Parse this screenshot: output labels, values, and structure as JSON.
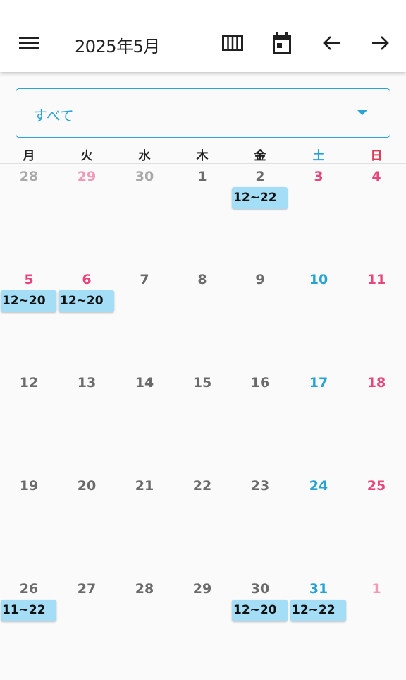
{
  "header": {
    "title": "2025年5月",
    "icons": [
      "menu-icon",
      "week-view-icon",
      "today-icon",
      "arrow-back-icon",
      "arrow-forward-icon"
    ]
  },
  "filter": {
    "selected": "すべて"
  },
  "weekdays": [
    "月",
    "火",
    "水",
    "木",
    "金",
    "土",
    "日"
  ],
  "colors": {
    "accent": "#2aa3d6",
    "saturday": "#25a3d5",
    "sunday_holiday": "#e8457a",
    "event_bg": "#a4ddf6",
    "out_of_month": "#a9a9a9"
  },
  "weeks": [
    [
      {
        "day": "28",
        "type": "out"
      },
      {
        "day": "29",
        "type": "out hol"
      },
      {
        "day": "30",
        "type": "out"
      },
      {
        "day": "1",
        "type": "normal"
      },
      {
        "day": "2",
        "type": "normal",
        "event": "12~22"
      },
      {
        "day": "3",
        "type": "hol"
      },
      {
        "day": "4",
        "type": "sun"
      }
    ],
    [
      {
        "day": "5",
        "type": "hol",
        "event": "12~20"
      },
      {
        "day": "6",
        "type": "hol",
        "event": "12~20"
      },
      {
        "day": "7",
        "type": "normal"
      },
      {
        "day": "8",
        "type": "normal"
      },
      {
        "day": "9",
        "type": "normal"
      },
      {
        "day": "10",
        "type": "sat"
      },
      {
        "day": "11",
        "type": "sun"
      }
    ],
    [
      {
        "day": "12",
        "type": "normal"
      },
      {
        "day": "13",
        "type": "normal"
      },
      {
        "day": "14",
        "type": "normal"
      },
      {
        "day": "15",
        "type": "normal"
      },
      {
        "day": "16",
        "type": "normal"
      },
      {
        "day": "17",
        "type": "sat"
      },
      {
        "day": "18",
        "type": "sun"
      }
    ],
    [
      {
        "day": "19",
        "type": "normal"
      },
      {
        "day": "20",
        "type": "normal"
      },
      {
        "day": "21",
        "type": "normal"
      },
      {
        "day": "22",
        "type": "normal"
      },
      {
        "day": "23",
        "type": "normal"
      },
      {
        "day": "24",
        "type": "sat"
      },
      {
        "day": "25",
        "type": "sun"
      }
    ],
    [
      {
        "day": "26",
        "type": "normal",
        "event": "11~22"
      },
      {
        "day": "27",
        "type": "normal"
      },
      {
        "day": "28",
        "type": "normal"
      },
      {
        "day": "29",
        "type": "normal"
      },
      {
        "day": "30",
        "type": "normal",
        "event": "12~20"
      },
      {
        "day": "31",
        "type": "sat",
        "event": "12~22"
      },
      {
        "day": "1",
        "type": "out sun"
      }
    ]
  ]
}
